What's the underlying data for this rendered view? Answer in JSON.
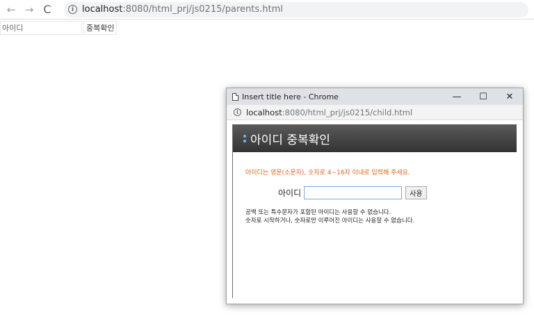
{
  "browser": {
    "back_glyph": "←",
    "forward_glyph": "→",
    "reload_glyph": "C",
    "url_host": "localhost",
    "url_path": ":8080/html_prj/js0215/parents.html",
    "info_glyph": "i"
  },
  "parent": {
    "id_placeholder": "아이디",
    "check_button_label": "중복확인"
  },
  "popup": {
    "title": "Insert title here - Chrome",
    "minimize_glyph": "—",
    "maximize_glyph": "☐",
    "close_glyph": "✕",
    "url_host": "localhost",
    "url_path": ":8080/html_prj/js0215/child.html",
    "info_glyph": "i",
    "header_title": "아이디 중복확인",
    "notice": "아이디는 영문(소문자), 숫자로 4~16자 이내로 입력해 주세요.",
    "id_label": "아이디",
    "id_value": "",
    "use_button_label": "사용",
    "rule_line_1": "공백 또는 특수문자가 포함된 아이디는 사용할 수 없습니다.",
    "rule_line_2": "숫자로 시작하거나, 숫자로만 이루어진 아이디는 사용할 수 없습니다."
  },
  "colors": {
    "notice": "#e0621f",
    "header_band": "#444444",
    "input_border": "#7aa7d6"
  }
}
